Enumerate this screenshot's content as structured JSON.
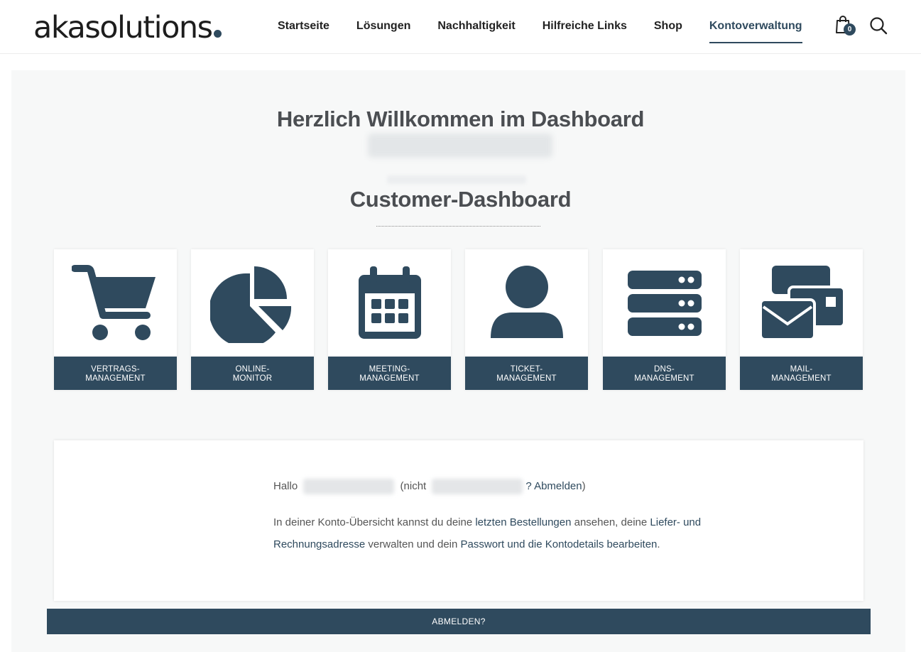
{
  "brand": {
    "logo_text": "akasolutions",
    "accent": "#2f4a5e"
  },
  "nav": {
    "items": [
      {
        "label": "Startseite"
      },
      {
        "label": "Lösungen"
      },
      {
        "label": "Nachhaltigkeit"
      },
      {
        "label": "Hilfreiche Links"
      },
      {
        "label": "Shop"
      },
      {
        "label": "Kontoverwaltung",
        "active": true
      }
    ],
    "cart_count": "0",
    "cart_icon": "shopping-bag-icon",
    "search_icon": "search-icon"
  },
  "dashboard": {
    "welcome": "Herzlich Willkommen im Dashboard",
    "title": "Customer-Dashboard",
    "tiles": [
      {
        "label_line1": "VERTRAGS-",
        "label_line2": "MANAGEMENT",
        "icon": "shopping-cart-icon"
      },
      {
        "label_line1": "ONLINE-",
        "label_line2": "MONITOR",
        "icon": "pie-chart-icon"
      },
      {
        "label_line1": "MEETING-",
        "label_line2": "MANAGEMENT",
        "icon": "calendar-icon"
      },
      {
        "label_line1": "TICKET-",
        "label_line2": "MANAGEMENT",
        "icon": "user-icon"
      },
      {
        "label_line1": "DNS-",
        "label_line2": "MANAGEMENT",
        "icon": "server-icon"
      },
      {
        "label_line1": "MAIL-",
        "label_line2": "MANAGEMENT",
        "icon": "mail-icon"
      }
    ]
  },
  "account": {
    "hello": "Hallo",
    "not_prefix": "(nicht",
    "logout_link": "? Abmelden",
    "close_paren": ")",
    "para_1": "In deiner Konto-Übersicht kannst du deine ",
    "link_orders": "letzten Bestellungen",
    "para_2": " ansehen, deine ",
    "link_address": "Liefer- und Rechnungsadresse",
    "para_3": " verwalten und dein ",
    "link_password": "Passwort und die Kontodetails bearbeiten",
    "para_4": "."
  },
  "logout_bar": {
    "label": "ABMELDEN?"
  }
}
